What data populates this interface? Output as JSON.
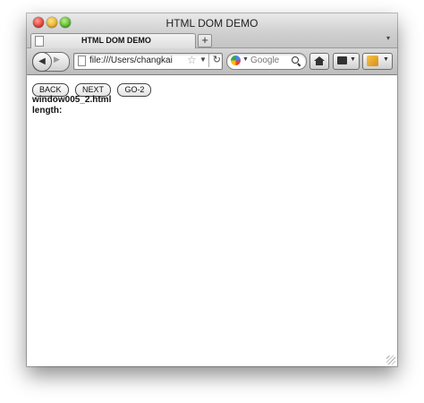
{
  "window": {
    "title": "HTML DOM DEMO"
  },
  "tabs": [
    {
      "label": "HTML DOM DEMO"
    }
  ],
  "tabstrip": {
    "new_tab_label": "+",
    "list_all_tabs": "▾"
  },
  "navbar": {
    "url": "file:///Users/changkai",
    "search_placeholder": "Google"
  },
  "page": {
    "buttons": [
      "BACK",
      "NEXT",
      "GO-2"
    ],
    "filename": "window005_2.html",
    "length_label": "length:"
  }
}
